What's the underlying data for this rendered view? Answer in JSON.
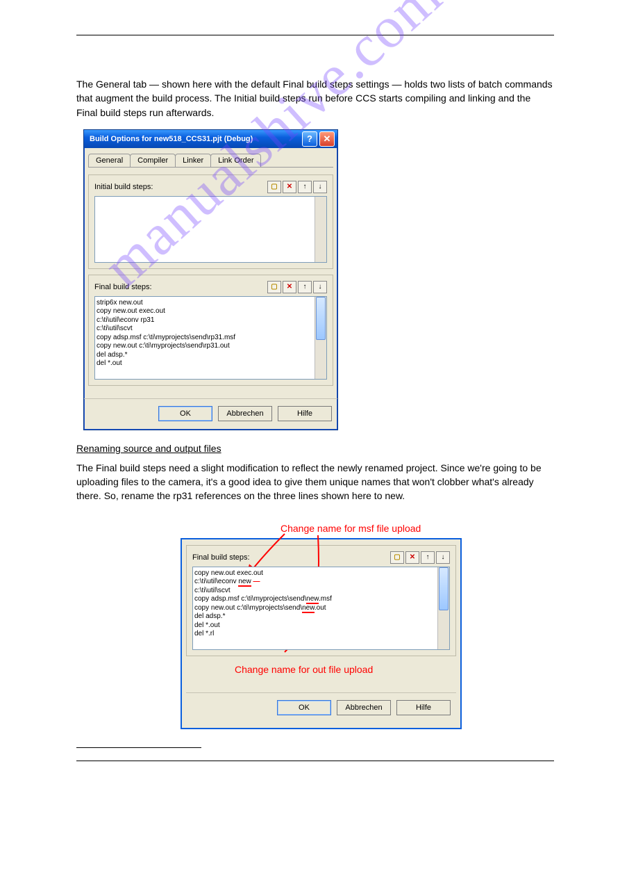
{
  "page_description": "The General tab — shown here with the default Final build steps settings — holds two lists of batch commands that augment the build process. The Initial build steps run before CCS starts compiling and linking and the Final build steps run afterwards.",
  "section": {
    "heading": "Renaming source and output files",
    "para1": "The Final build steps need a slight modification to reflect the newly renamed project. Since we're going to be uploading files to the camera, it's a good idea to give them unique names that won't clobber what's already there. So, rename the rp31 references on the three lines shown here to new."
  },
  "footer_last_line_note": "",
  "dialog1": {
    "title": "Build Options for new518_CCS31.pjt (Debug)",
    "tabs": [
      "General",
      "Compiler",
      "Linker",
      "Link Order"
    ],
    "initial_label": "Initial build steps:",
    "final_label": "Final build steps:",
    "final_lines": {
      "l0": "strip6x new.out",
      "l1": "copy new.out exec.out",
      "l2": "c:\\ti\\util\\econv rp31",
      "l3": "c:\\ti\\util\\scvt",
      "l4": "copy adsp.msf c:\\ti\\myprojects\\send\\rp31.msf",
      "l5": "copy new.out c:\\ti\\myprojects\\send\\rp31.out",
      "l6": "del adsp.*",
      "l7": "del *.out"
    },
    "buttons": {
      "ok": "OK",
      "cancel": "Abbrechen",
      "help": "Hilfe"
    }
  },
  "dialog2": {
    "final_label": "Final build steps:",
    "annot_top": "Change name for msf file upload",
    "annot_bottom": "Change name for out file upload",
    "lines": {
      "l0": "copy new.out exec.out",
      "l1a": "c:\\ti\\util\\econv ",
      "l1b": "new",
      "l2": "c:\\ti\\util\\scvt",
      "l3a": "copy adsp.msf c:\\ti\\myprojects\\send\\",
      "l3b": "new",
      "l3c": ".msf",
      "l4a": "copy new.out c:\\ti\\myprojects\\send\\",
      "l4b": "new",
      "l4c": ".out",
      "l5": "del adsp.*",
      "l6": "del *.out",
      "l7": "del *.rl"
    },
    "buttons": {
      "ok": "OK",
      "cancel": "Abbrechen",
      "help": "Hilfe"
    }
  }
}
